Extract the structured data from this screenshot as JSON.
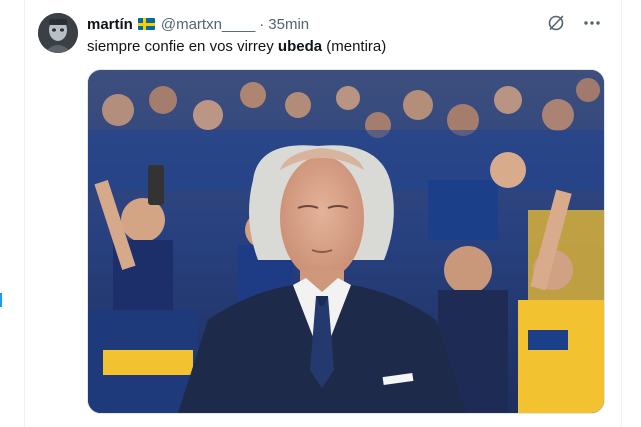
{
  "author": {
    "name": "martín",
    "flag": "sweden-flag-icon",
    "handle": "@martxn____",
    "separator": "·",
    "time": "35min"
  },
  "tweet": {
    "text_before": "siempre confie en vos virrey ",
    "text_bold": "ubeda",
    "text_after": " (mentira)"
  },
  "actions": {
    "grok_icon": "grok-icon",
    "more_icon": "more-icon"
  },
  "media": {
    "description_icon": "photo",
    "colors": {
      "crowd_blue": "#1c3f8a",
      "crowd_yellow": "#f2c230",
      "suit": "#1d2a4a"
    }
  }
}
